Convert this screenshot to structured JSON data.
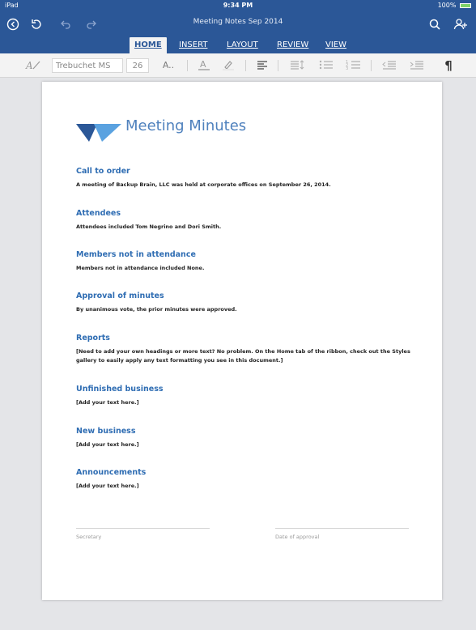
{
  "status": {
    "device": "iPad",
    "time": "9:34 PM",
    "battery": "100%"
  },
  "document_title": "Meeting Notes Sep 2014",
  "icons": {
    "back": "back-circle-icon",
    "save": "save-sync-icon",
    "undo": "undo-icon",
    "redo": "redo-icon",
    "search": "search-icon",
    "share": "add-person-icon"
  },
  "tabs": [
    {
      "label": "HOME",
      "active": true
    },
    {
      "label": "INSERT",
      "active": false
    },
    {
      "label": "LAYOUT",
      "active": false
    },
    {
      "label": "REVIEW",
      "active": false
    },
    {
      "label": "VIEW",
      "active": false
    }
  ],
  "ribbon": {
    "font_name": "Trebuchet MS",
    "font_size": "26",
    "font_more": "A.."
  },
  "doc": {
    "heading": "Meeting Minutes",
    "sections": [
      {
        "title": "Call to order",
        "body": "A meeting of Backup Brain, LLC was held at corporate offices on September 26, 2014."
      },
      {
        "title": "Attendees",
        "body": "Attendees included Tom Negrino and Dori Smith."
      },
      {
        "title": "Members not in attendance",
        "body": "Members not in attendance included None."
      },
      {
        "title": "Approval of minutes",
        "body": "By unanimous vote, the prior minutes were approved."
      },
      {
        "title": "Reports",
        "body": "[Need to add your own headings or more text? No problem. On the Home tab of the ribbon, check out the Styles gallery to easily apply any text formatting you see in this document.]"
      },
      {
        "title": "Unfinished business",
        "body": "[Add your text here.]"
      },
      {
        "title": "New business",
        "body": "[Add your text here.]"
      },
      {
        "title": "Announcements",
        "body": "[Add your text here.]"
      }
    ],
    "signature_left": "Secretary",
    "signature_right": "Date of approval"
  },
  "colors": {
    "appbar": "#2b5797",
    "heading": "#4f81bd",
    "section": "#2f6db3",
    "logo_dark": "#2b5797",
    "logo_light": "#5aa2e0"
  }
}
